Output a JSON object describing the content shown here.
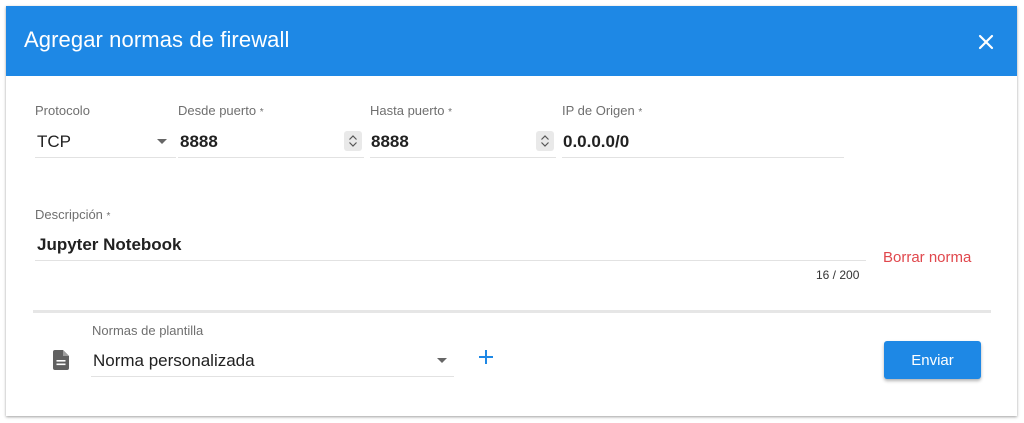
{
  "dialog": {
    "title": "Agregar normas de firewall",
    "close_icon": "close-icon"
  },
  "rule": {
    "protocol": {
      "label": "Protocolo",
      "value": "TCP"
    },
    "from_port": {
      "label": "Desde puerto",
      "required_mark": "*",
      "value": "8888"
    },
    "to_port": {
      "label": "Hasta puerto",
      "required_mark": "*",
      "value": "8888"
    },
    "source_ip": {
      "label": "IP de Origen",
      "required_mark": "*",
      "value": "0.0.0.0/0"
    },
    "description": {
      "label": "Descripción",
      "required_mark": "*",
      "value": "Jupyter Notebook",
      "counter": "16 / 200"
    },
    "delete_label": "Borrar norma"
  },
  "template": {
    "label": "Normas de plantilla",
    "value": "Norma personalizada",
    "icon": "document-icon",
    "add_icon": "plus-icon"
  },
  "actions": {
    "submit_label": "Enviar"
  },
  "colors": {
    "primary": "#1e88e5",
    "danger": "#e0474c"
  }
}
